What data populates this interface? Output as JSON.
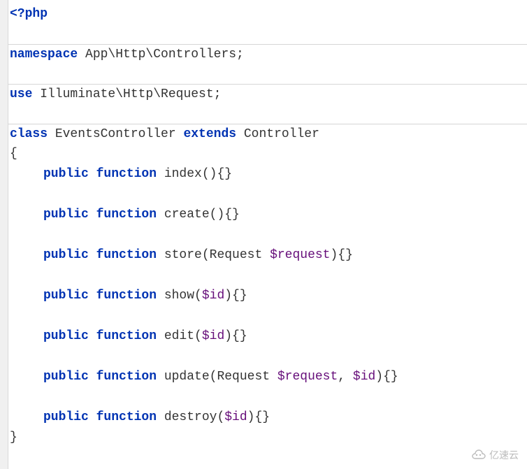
{
  "code": {
    "l1": "<?php",
    "l2_kw": "namespace",
    "l2_rest": " App\\Http\\Controllers;",
    "l3_kw": "use",
    "l3_rest": " Illuminate\\Http\\Request;",
    "l4_kw1": "class",
    "l4_cls": " EventsController ",
    "l4_kw2": "extends",
    "l4_rest": " Controller",
    "l5": "{",
    "pf": "public",
    "fn": " function",
    "m1": " index(){}",
    "m2": " create(){}",
    "m3a": " store(Request ",
    "m3v": "$request",
    "m3b": "){}",
    "m4a": " show(",
    "m4v": "$id",
    "m4b": "){}",
    "m5a": " edit(",
    "m5v": "$id",
    "m5b": "){}",
    "m6a": " update(Request ",
    "m6v1": "$request",
    "m6m": ", ",
    "m6v2": "$id",
    "m6b": "){}",
    "m7a": " destroy(",
    "m7v": "$id",
    "m7b": "){}",
    "lend": "}"
  },
  "watermark": {
    "text": "亿速云"
  }
}
